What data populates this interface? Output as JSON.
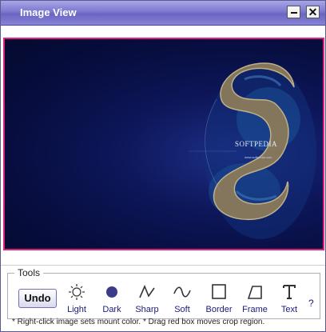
{
  "window": {
    "title": "Image View",
    "minimize_icon": "minimize-icon",
    "close_glyph": "✕"
  },
  "image": {
    "watermark_brand": "SOFTPEDIA",
    "watermark_url": "www.softpedia.com"
  },
  "tools": {
    "group_label": "Tools",
    "undo_label": "Undo",
    "items": [
      {
        "label": "Light",
        "icon": "sun-icon"
      },
      {
        "label": "Dark",
        "icon": "filled-circle-icon"
      },
      {
        "label": "Sharp",
        "icon": "sharp-wave-icon"
      },
      {
        "label": "Soft",
        "icon": "soft-wave-icon"
      },
      {
        "label": "Border",
        "icon": "square-icon"
      },
      {
        "label": "Frame",
        "icon": "parallelogram-icon"
      },
      {
        "label": "Text",
        "icon": "text-t-icon"
      }
    ],
    "help_label": "?"
  },
  "status": {
    "hint": "* Right-click image sets mount color.   * Drag red box moves crop region."
  },
  "colors": {
    "crop_box": "#e0207a",
    "title_bar": "#7c78cf",
    "tool_label": "#1a1a7a"
  }
}
